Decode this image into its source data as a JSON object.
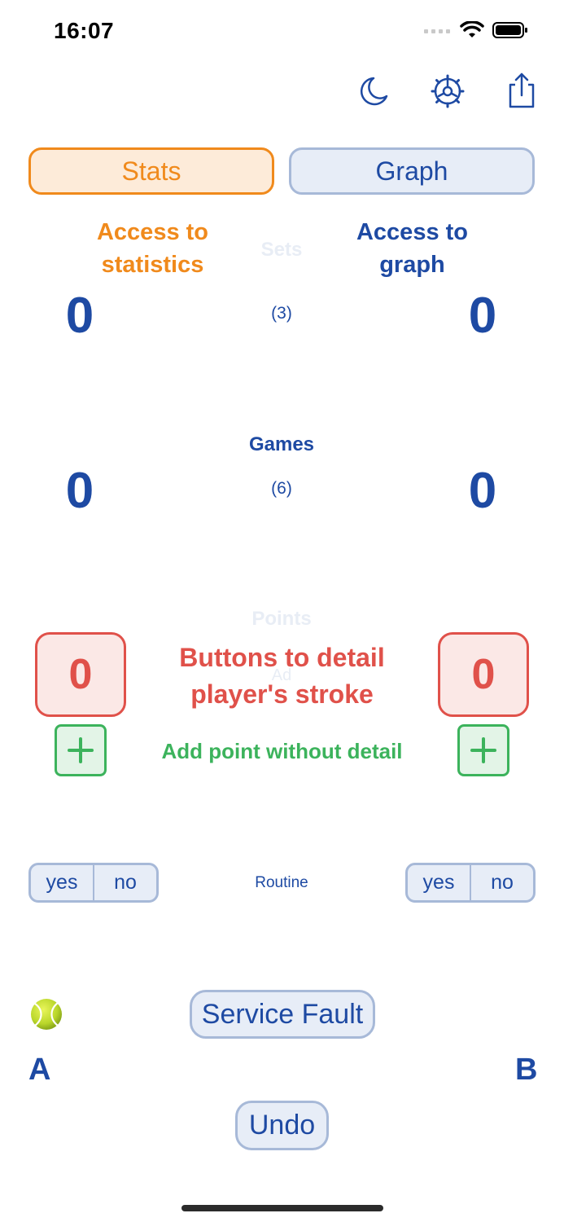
{
  "status_bar": {
    "time": "16:07"
  },
  "toolbar": {
    "icons": [
      "moon-icon",
      "gear-icon",
      "share-icon"
    ]
  },
  "tabs": {
    "stats": "Stats",
    "graph": "Graph"
  },
  "callouts": {
    "stats_line1": "Access to",
    "stats_line2": "statistics",
    "graph_line1": "Access to",
    "graph_line2": "graph",
    "stroke_line1": "Buttons to detail",
    "stroke_line2": "player's stroke",
    "add_point": "Add point without detail"
  },
  "sets": {
    "label": "Sets",
    "player_a": "0",
    "player_b": "0",
    "best_of": "(3)"
  },
  "games": {
    "label": "Games",
    "player_a": "0",
    "player_b": "0",
    "target": "(6)"
  },
  "points": {
    "label": "Points",
    "player_a": "0",
    "player_b": "0",
    "advantage": "Ad"
  },
  "routine": {
    "label": "Routine",
    "player_a": {
      "yes": "yes",
      "no": "no"
    },
    "player_b": {
      "yes": "yes",
      "no": "no"
    }
  },
  "actions": {
    "service_fault": "Service Fault",
    "undo": "Undo"
  },
  "players": {
    "a": "A",
    "b": "B",
    "server_icon": "tennis-ball-icon"
  },
  "colors": {
    "primary_blue": "#1e4aa3",
    "orange": "#f08a1c",
    "red": "#e0514a",
    "green": "#3cb35c",
    "light_blue_bg": "#e7edf7",
    "border_blue": "#a7b9d8"
  }
}
